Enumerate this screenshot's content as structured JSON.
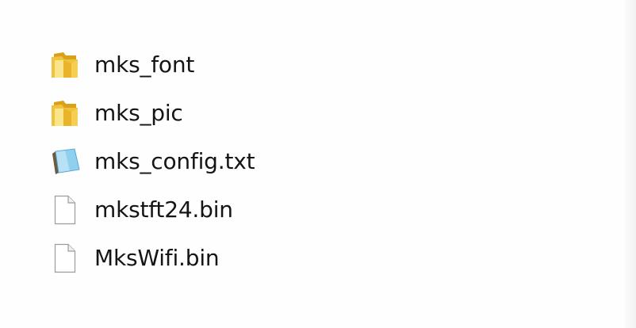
{
  "files": [
    {
      "name": "mks_font",
      "icon": "folder-icon",
      "type": "folder"
    },
    {
      "name": "mks_pic",
      "icon": "folder-icon",
      "type": "folder"
    },
    {
      "name": "mks_config.txt",
      "icon": "text-file-icon",
      "type": "text"
    },
    {
      "name": "mkstft24.bin",
      "icon": "file-icon",
      "type": "binary"
    },
    {
      "name": "MksWifi.bin",
      "icon": "file-icon",
      "type": "binary"
    }
  ],
  "colors": {
    "folder": "#e9bd34",
    "folder_light": "#fbe58a",
    "text_icon": "#7fc4e5",
    "file_border": "#9c9c9c"
  }
}
